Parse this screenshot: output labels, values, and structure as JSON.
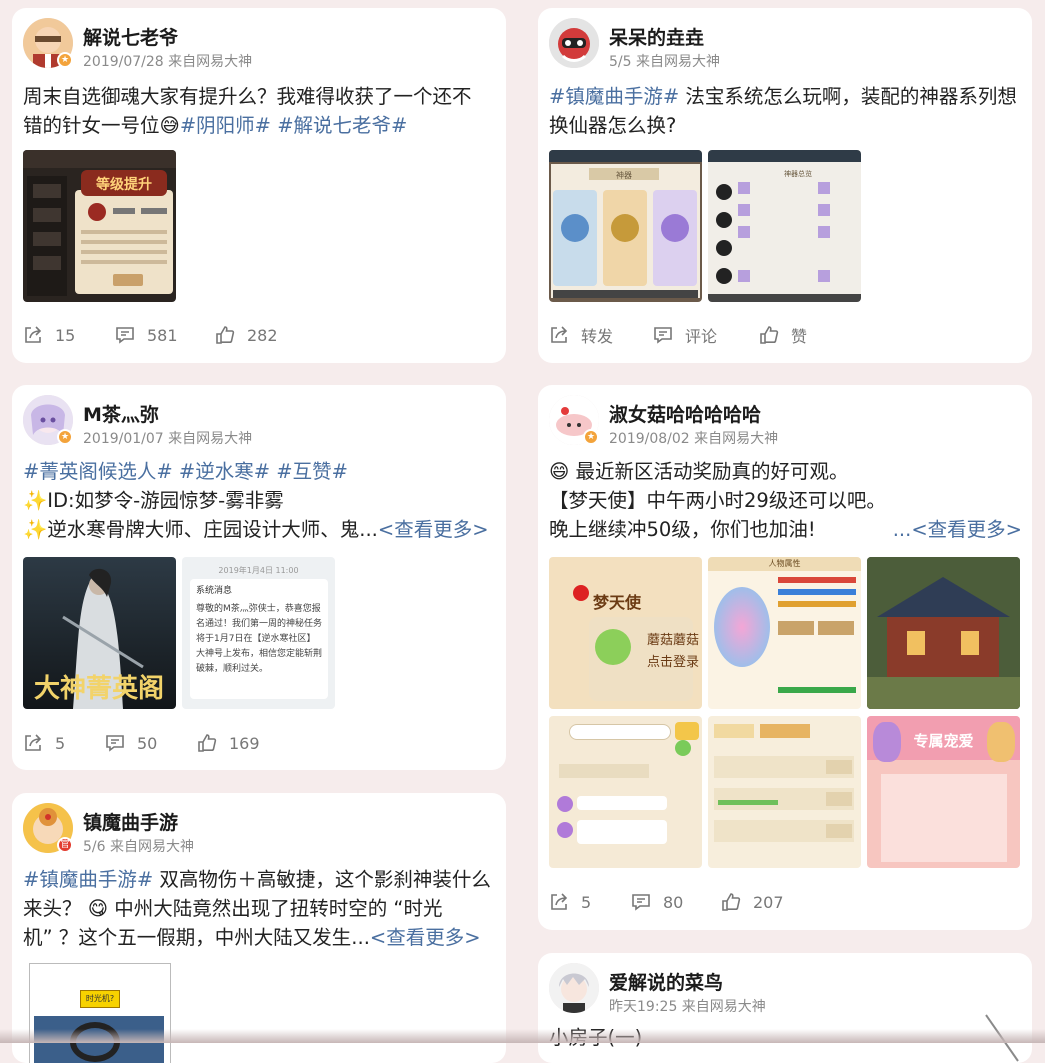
{
  "posts": {
    "p1": {
      "name": "解说七老爷",
      "meta": "2019/07/28 来自网易大神",
      "line1": "周末自选御魂大家有提升么？我难得收获了一个还不",
      "line2_plain": "错的针女一号位😅",
      "tags": "#阴阳师# #解说七老爷#",
      "img_title": "等级提升",
      "repost": "15",
      "comment": "581",
      "like": "282"
    },
    "p2": {
      "name": "呆呆的垚垚",
      "meta": "5/5 来自网易大神",
      "tag": "#镇魔曲手游#",
      "line1": " 法宝系统怎么玩啊，装配的神器系列想",
      "line2": "换仙器怎么换?",
      "img1_title": "神器",
      "img2_title": "神器总览",
      "repost": "转发",
      "comment": "评论",
      "like": "赞"
    },
    "p3": {
      "name": "M茶灬弥",
      "meta": "2019/01/07 来自网易大神",
      "tags": "#菁英阁候选人# #逆水寒# #互赞#",
      "line2": "✨ID:如梦令-游园惊梦-雾非雾",
      "line3": "✨逆水寒骨牌大师、庄园设计大师、鬼...",
      "more": "<查看更多>",
      "img1_text": "大神菁英阁",
      "msg_date": "2019年1月4日 11:00",
      "msg_title": "系统消息",
      "msg_body": "尊敬的M茶灬弥侠士，恭喜您报名通过！我们第一周的神秘任务将于1月7日在【逆水寒社区】大神号上发布，相信您定能斩荆破棘，顺利过关。",
      "repost": "5",
      "comment": "50",
      "like": "169"
    },
    "p4": {
      "name": "淑女菇哈哈哈哈哈",
      "meta": "2019/08/02 来自网易大神",
      "line1": "😄 最近新区活动奖励真的好可观。",
      "line2": "【梦天使】中午两小时29级还可以吧。",
      "line3": "晚上继续冲50级，你们也加油!",
      "more": "...<查看更多>",
      "img1_text": "梦天使",
      "img1_sub": "蘑菇蘑菇",
      "img1_sub2": "点击登录",
      "img2_title": "人物属性",
      "img6_title": "专属宠爱",
      "repost": "5",
      "comment": "80",
      "like": "207"
    },
    "p5": {
      "name": "镇魔曲手游",
      "meta": "5/6 来自网易大神",
      "tag": "#镇魔曲手游#",
      "line1": " 双高物伤＋高敏捷，这个影刹神装什么",
      "line2": "来头？ 😋 中州大陆竟然出现了扭转时空的 “时光",
      "line3": "机” ？这个五一假期，中州大陆又发生...",
      "more": "<查看更多>",
      "img_label": "时光机?"
    },
    "p6": {
      "name": "爱解说的菜鸟",
      "meta": "昨天19:25 来自网易大神",
      "line1": "小房子(一)"
    }
  },
  "icons": {
    "repost": "share-icon",
    "comment": "comment-icon",
    "like": "thumbs-up-icon"
  },
  "colors": {
    "background": "#f6ecec",
    "tag": "#4a6fa0",
    "meta": "#8a8a8a",
    "vip_badge": "#f3a33b",
    "official_badge": "#e23b2e"
  }
}
